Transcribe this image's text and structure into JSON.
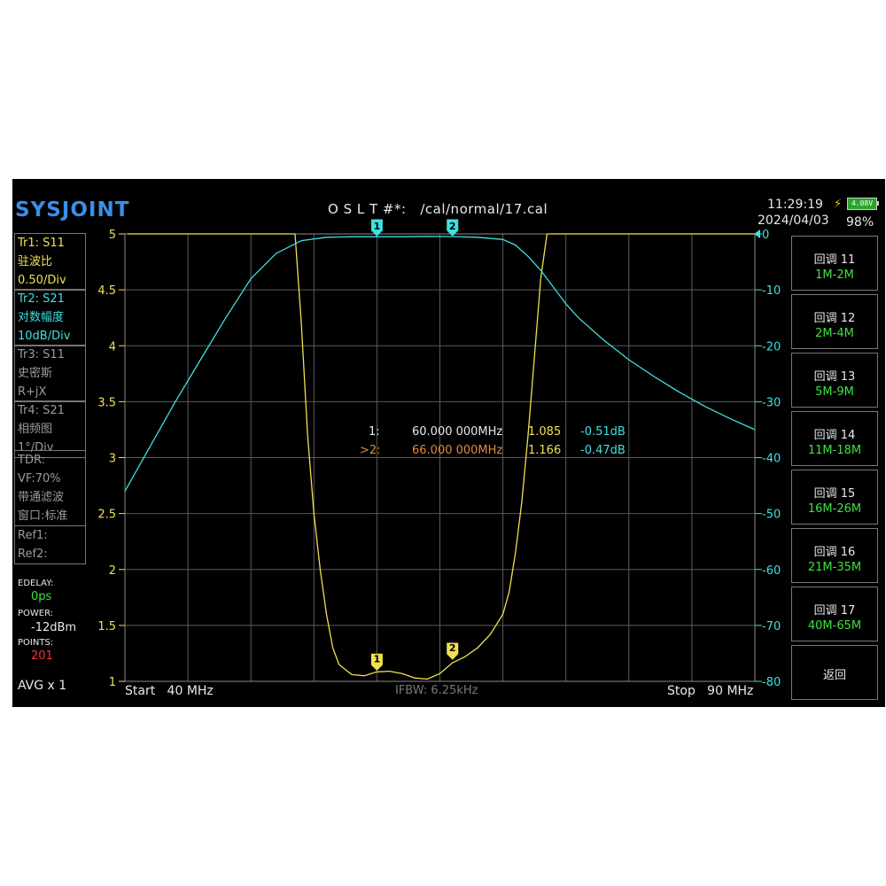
{
  "header": {
    "logo": "SYSJOINT",
    "cal_status": "O S L T #*:   /cal/normal/17.cal",
    "time": "11:29:19",
    "date": "2024/04/03",
    "battery_voltage": "4.08V",
    "battery_percent": "98%"
  },
  "traces": [
    {
      "line1": "Tr1:   S11",
      "line2": "驻波比",
      "line3": "0.50/Div",
      "color": "#f0e050"
    },
    {
      "line1": "Tr2:   S21",
      "line2": "对数幅度",
      "line3": "10dB/Div",
      "color": "#3ee0e0"
    },
    {
      "line1": "Tr3:   S11",
      "line2": "史密斯",
      "line3": "R+jX",
      "color": "#9a9a9a"
    },
    {
      "line1": "Tr4:   S21",
      "line2": "相频图",
      "line3": "1°/Div",
      "color": "#9a9a9a"
    }
  ],
  "tdr": {
    "line1": "TDR:",
    "line2": "VF:70%",
    "line3": "带通滤波",
    "line4": "窗口:标准"
  },
  "refs": {
    "ref1": "Ref1:",
    "ref2": "Ref2:"
  },
  "status": {
    "edelay_label": "EDELAY:",
    "edelay_value": "0ps",
    "power_label": "POWER:",
    "power_value": "-12dBm",
    "points_label": "POINTS:",
    "points_value": "201",
    "avg": "AVG x 1"
  },
  "left_axis": {
    "ticks": [
      "5",
      "4.5",
      "4",
      "3.5",
      "3",
      "2.5",
      "2",
      "1.5",
      "1"
    ]
  },
  "right_axis": {
    "ticks": [
      "0",
      "-10",
      "-20",
      "-30",
      "-40",
      "-50",
      "-60",
      "-70",
      "-80"
    ]
  },
  "markers": {
    "m1": {
      "prefix": "1:",
      "freq": "60.000 000MHz",
      "swr": "1.085",
      "db": "-0.51dB"
    },
    "m2": {
      "prefix": ">2:",
      "freq": "66.000 000MHz",
      "swr": "1.166",
      "db": "-0.47dB"
    },
    "m1_label": "1",
    "m2_label": "2"
  },
  "bottom": {
    "start": "Start   40 MHz",
    "ifbw": "IFBW: 6.25kHz",
    "stop": "Stop   90 MHz"
  },
  "buttons": [
    {
      "label": "回调 11",
      "range": "1M-2M"
    },
    {
      "label": "回调 12",
      "range": "2M-4M"
    },
    {
      "label": "回调 13",
      "range": "5M-9M"
    },
    {
      "label": "回调 14",
      "range": "11M-18M"
    },
    {
      "label": "回调 15",
      "range": "16M-26M"
    },
    {
      "label": "回调 16",
      "range": "21M-35M"
    },
    {
      "label": "回调 17",
      "range": "40M-65M"
    },
    {
      "label": "返回",
      "range": ""
    }
  ],
  "chart_data": {
    "type": "line",
    "x_unit": "MHz",
    "xlim": [
      40,
      90
    ],
    "y_left_lim": [
      1,
      5
    ],
    "y_right_lim": [
      -80,
      0
    ],
    "grid": true,
    "series": [
      {
        "name": "Tr1: S11",
        "axis": "left",
        "color": "#f0e050",
        "x": [
          53.5,
          54.0,
          54.5,
          55.0,
          55.5,
          56.0,
          56.5,
          57.0,
          58.0,
          59.0,
          60.0,
          61.0,
          62.0,
          63.0,
          64.0,
          65.0,
          66.0,
          67.0,
          68.0,
          69.0,
          70.0,
          70.5,
          71.0,
          71.5,
          72.0,
          72.5,
          73.0,
          73.5
        ],
        "y": [
          5.0,
          4.2,
          3.2,
          2.5,
          2.0,
          1.6,
          1.3,
          1.15,
          1.06,
          1.05,
          1.085,
          1.09,
          1.07,
          1.03,
          1.02,
          1.07,
          1.166,
          1.22,
          1.3,
          1.42,
          1.6,
          1.8,
          2.15,
          2.6,
          3.2,
          3.9,
          4.6,
          5.0
        ]
      },
      {
        "name": "Tr2: S21",
        "axis": "right",
        "color": "#3ee0e0",
        "x": [
          40,
          42,
          44,
          46,
          48,
          50,
          52,
          54,
          56,
          58,
          60,
          62,
          64,
          66,
          68,
          70,
          71,
          72,
          73,
          74,
          75,
          76,
          78,
          80,
          82,
          84,
          86,
          88,
          90
        ],
        "y": [
          -46,
          -38,
          -30,
          -22.5,
          -15,
          -8,
          -3.5,
          -1.2,
          -0.6,
          -0.5,
          -0.51,
          -0.5,
          -0.45,
          -0.47,
          -0.6,
          -1.0,
          -2.0,
          -4.0,
          -6.5,
          -9.5,
          -12.5,
          -15.0,
          -19.0,
          -22.5,
          -25.5,
          -28.3,
          -30.8,
          -33.0,
          -35.0
        ]
      }
    ],
    "markers": [
      {
        "id": 1,
        "x": 60.0,
        "swr": 1.085,
        "s21_db": -0.51
      },
      {
        "id": 2,
        "x": 66.0,
        "swr": 1.166,
        "s21_db": -0.47
      }
    ]
  }
}
